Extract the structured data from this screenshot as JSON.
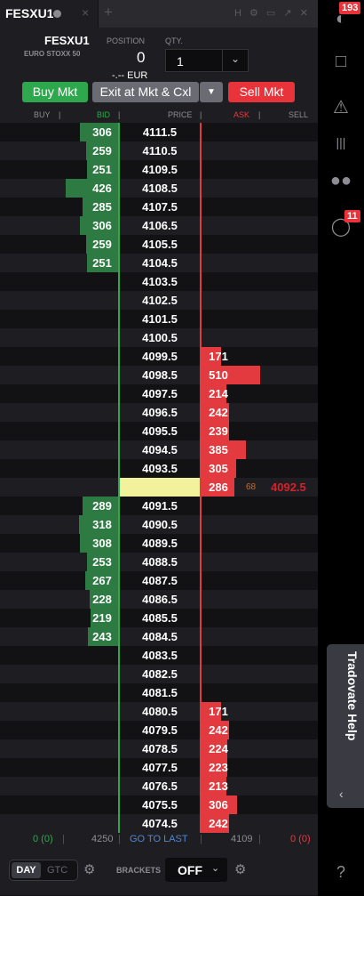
{
  "tab": {
    "title": "FESXU1",
    "close": "×",
    "add": "+",
    "tools": "H ⚙ ▭ ↗ ✕"
  },
  "header": {
    "instrument": "FESXU1",
    "description": "EURO STOXX 50",
    "position_label": "POSITION",
    "position_value": "0",
    "pnl": "-.-- EUR",
    "qty_label": "QTY.",
    "qty_value": "1"
  },
  "buttons": {
    "buy": "Buy Mkt",
    "exit": "Exit at Mkt & Cxl",
    "sell": "Sell Mkt"
  },
  "columns": {
    "buy": "BUY",
    "bid": "BID",
    "price": "PRICE",
    "ask": "ASK",
    "sell": "SELL"
  },
  "colors": {
    "bid": "#2ea84c",
    "ask": "#e33a3f",
    "last_bg": "#f2f29d"
  },
  "ladder": [
    {
      "price": "4111.5",
      "bid": "306",
      "ask": ""
    },
    {
      "price": "4110.5",
      "bid": "259",
      "ask": ""
    },
    {
      "price": "4109.5",
      "bid": "251",
      "ask": ""
    },
    {
      "price": "4108.5",
      "bid": "426",
      "ask": ""
    },
    {
      "price": "4107.5",
      "bid": "285",
      "ask": ""
    },
    {
      "price": "4106.5",
      "bid": "306",
      "ask": ""
    },
    {
      "price": "4105.5",
      "bid": "259",
      "ask": ""
    },
    {
      "price": "4104.5",
      "bid": "251",
      "ask": ""
    },
    {
      "price": "4103.5",
      "bid": "",
      "ask": ""
    },
    {
      "price": "4102.5",
      "bid": "",
      "ask": ""
    },
    {
      "price": "4101.5",
      "bid": "",
      "ask": ""
    },
    {
      "price": "4100.5",
      "bid": "",
      "ask": ""
    },
    {
      "price": "4099.5",
      "bid": "",
      "ask": "171"
    },
    {
      "price": "4098.5",
      "bid": "",
      "ask": "510"
    },
    {
      "price": "4097.5",
      "bid": "",
      "ask": "214"
    },
    {
      "price": "4096.5",
      "bid": "",
      "ask": "242"
    },
    {
      "price": "4095.5",
      "bid": "",
      "ask": "239"
    },
    {
      "price": "4094.5",
      "bid": "",
      "ask": "385"
    },
    {
      "price": "4093.5",
      "bid": "",
      "ask": "305"
    },
    {
      "price": "4092.5",
      "bid": "",
      "ask": "286",
      "last": true,
      "last_volume": "68"
    },
    {
      "price": "4091.5",
      "bid": "289",
      "ask": ""
    },
    {
      "price": "4090.5",
      "bid": "318",
      "ask": ""
    },
    {
      "price": "4089.5",
      "bid": "308",
      "ask": ""
    },
    {
      "price": "4088.5",
      "bid": "253",
      "ask": ""
    },
    {
      "price": "4087.5",
      "bid": "267",
      "ask": ""
    },
    {
      "price": "4086.5",
      "bid": "228",
      "ask": ""
    },
    {
      "price": "4085.5",
      "bid": "219",
      "ask": ""
    },
    {
      "price": "4084.5",
      "bid": "243",
      "ask": ""
    },
    {
      "price": "4083.5",
      "bid": "",
      "ask": ""
    },
    {
      "price": "4082.5",
      "bid": "",
      "ask": ""
    },
    {
      "price": "4081.5",
      "bid": "",
      "ask": ""
    },
    {
      "price": "4080.5",
      "bid": "",
      "ask": "171"
    },
    {
      "price": "4079.5",
      "bid": "",
      "ask": "242"
    },
    {
      "price": "4078.5",
      "bid": "",
      "ask": "224"
    },
    {
      "price": "4077.5",
      "bid": "",
      "ask": "223"
    },
    {
      "price": "4076.5",
      "bid": "",
      "ask": "213"
    },
    {
      "price": "4075.5",
      "bid": "",
      "ask": "306"
    },
    {
      "price": "4074.5",
      "bid": "",
      "ask": "242"
    }
  ],
  "footer": {
    "buy_total": "0 (0)",
    "bid_total": "4250",
    "go_to_last": "GO TO LAST",
    "ask_total": "4109",
    "sell_total": "0 (0)"
  },
  "bottom": {
    "day": "DAY",
    "gtc": "GTC",
    "brackets_label": "BRACKETS",
    "brackets_value": "OFF"
  },
  "sidebar": {
    "notifications_badge": "193",
    "trophy_badge": "11",
    "help_label": "Tradovate Help",
    "help_chevron": "‹",
    "question": "?"
  }
}
